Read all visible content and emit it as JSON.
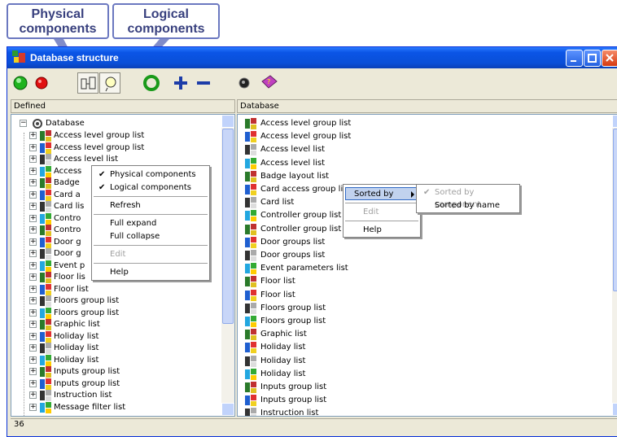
{
  "callouts": {
    "physical": [
      "Physical",
      "components"
    ],
    "logical": [
      "Logical",
      "components"
    ]
  },
  "window": {
    "title": "Database structure"
  },
  "toolbar": {
    "buttons": [
      "green-circle-icon",
      "red-circle-icon",
      "physical-components-icon",
      "logical-components-icon",
      "recycle-icon",
      "plus-icon",
      "minus-icon",
      "record-icon",
      "help-book-icon"
    ]
  },
  "left_pane": {
    "header": "Defined",
    "root": "Database",
    "items": [
      "Access level group list",
      "Access level group list",
      "Access level list",
      "Access",
      "Badge",
      "Card a",
      "Card lis",
      "Contro",
      "Contro",
      "Door g",
      "Door g",
      "Event p",
      "Floor lis",
      "Floor list",
      "Floors group list",
      "Floors group list",
      "Graphic list",
      "Holiday list",
      "Holiday list",
      "Holiday list",
      "Inputs group list",
      "Inputs group list",
      "Instruction list",
      "Message filter list"
    ]
  },
  "right_pane": {
    "header": "Database",
    "items": [
      "Access level group list",
      "Access level group list",
      "Access level list",
      "Access level list",
      "Badge layout list",
      "Card access group list",
      "Card list",
      "Controller group list",
      "Controller group list",
      "Door groups list",
      "Door groups list",
      "Event parameters list",
      "Floor list",
      "Floor list",
      "Floors group list",
      "Floors group list",
      "Graphic list",
      "Holiday list",
      "Holiday list",
      "Holiday list",
      "Inputs group list",
      "Inputs group list",
      "Instruction list"
    ]
  },
  "context_menu_left": {
    "physical": "Physical components",
    "logical": "Logical components",
    "refresh": "Refresh",
    "full_expand": "Full expand",
    "full_collapse": "Full collapse",
    "edit": "Edit",
    "help": "Help"
  },
  "context_menu_right": {
    "sorted_by": "Sorted by",
    "edit": "Edit",
    "help": "Help"
  },
  "submenu": {
    "by_component": "Sorted by component",
    "by_name": "Sorted by name"
  },
  "status": {
    "count": "36"
  },
  "colors": {
    "title_blue": "#0a4fd8",
    "callout_text": "#38407e",
    "menu_highlight": "#c1d2ee"
  }
}
